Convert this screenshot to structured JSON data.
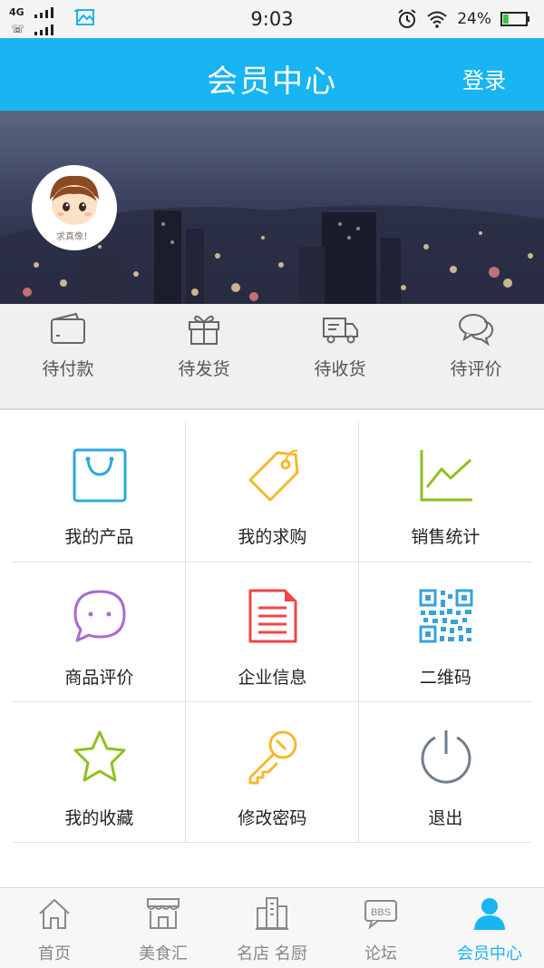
{
  "status_bar": {
    "network": "4G",
    "time": "9:03",
    "battery_percent": "24%",
    "battery_level": 0.24
  },
  "header": {
    "title": "会员中心",
    "login_label": "登录"
  },
  "profile": {
    "avatar_caption": "求真像！"
  },
  "orders": [
    {
      "label": "待付款",
      "icon": "wallet-icon"
    },
    {
      "label": "待发货",
      "icon": "gift-icon"
    },
    {
      "label": "待收货",
      "icon": "truck-icon"
    },
    {
      "label": "待评价",
      "icon": "chat-bubbles-icon"
    }
  ],
  "functions": [
    {
      "label": "我的产品",
      "icon": "shopping-bag-icon",
      "color": "#2fa7e0"
    },
    {
      "label": "我的求购",
      "icon": "tag-icon",
      "color": "#f5b82e"
    },
    {
      "label": "销售统计",
      "icon": "line-chart-icon",
      "color": "#8cc21f"
    },
    {
      "label": "商品评价",
      "icon": "speech-bubble-icon",
      "color": "#a96bd1"
    },
    {
      "label": "企业信息",
      "icon": "document-icon",
      "color": "#f0454a"
    },
    {
      "label": "二维码",
      "icon": "qr-code-icon",
      "color": "#3aa0dc"
    },
    {
      "label": "我的收藏",
      "icon": "star-icon",
      "color": "#8cc21f"
    },
    {
      "label": "修改密码",
      "icon": "key-icon",
      "color": "#f5b82e"
    },
    {
      "label": "退出",
      "icon": "power-icon",
      "color": "#6f7e8c"
    }
  ],
  "nav": {
    "active_color": "#19b4f2",
    "items": [
      {
        "label": "首页",
        "icon": "home-icon"
      },
      {
        "label": "美食汇",
        "icon": "storefront-icon"
      },
      {
        "label": "名店 名厨",
        "icon": "buildings-icon"
      },
      {
        "label": "论坛",
        "icon": "bbs-icon"
      },
      {
        "label": "会员中心",
        "icon": "user-icon"
      }
    ]
  }
}
